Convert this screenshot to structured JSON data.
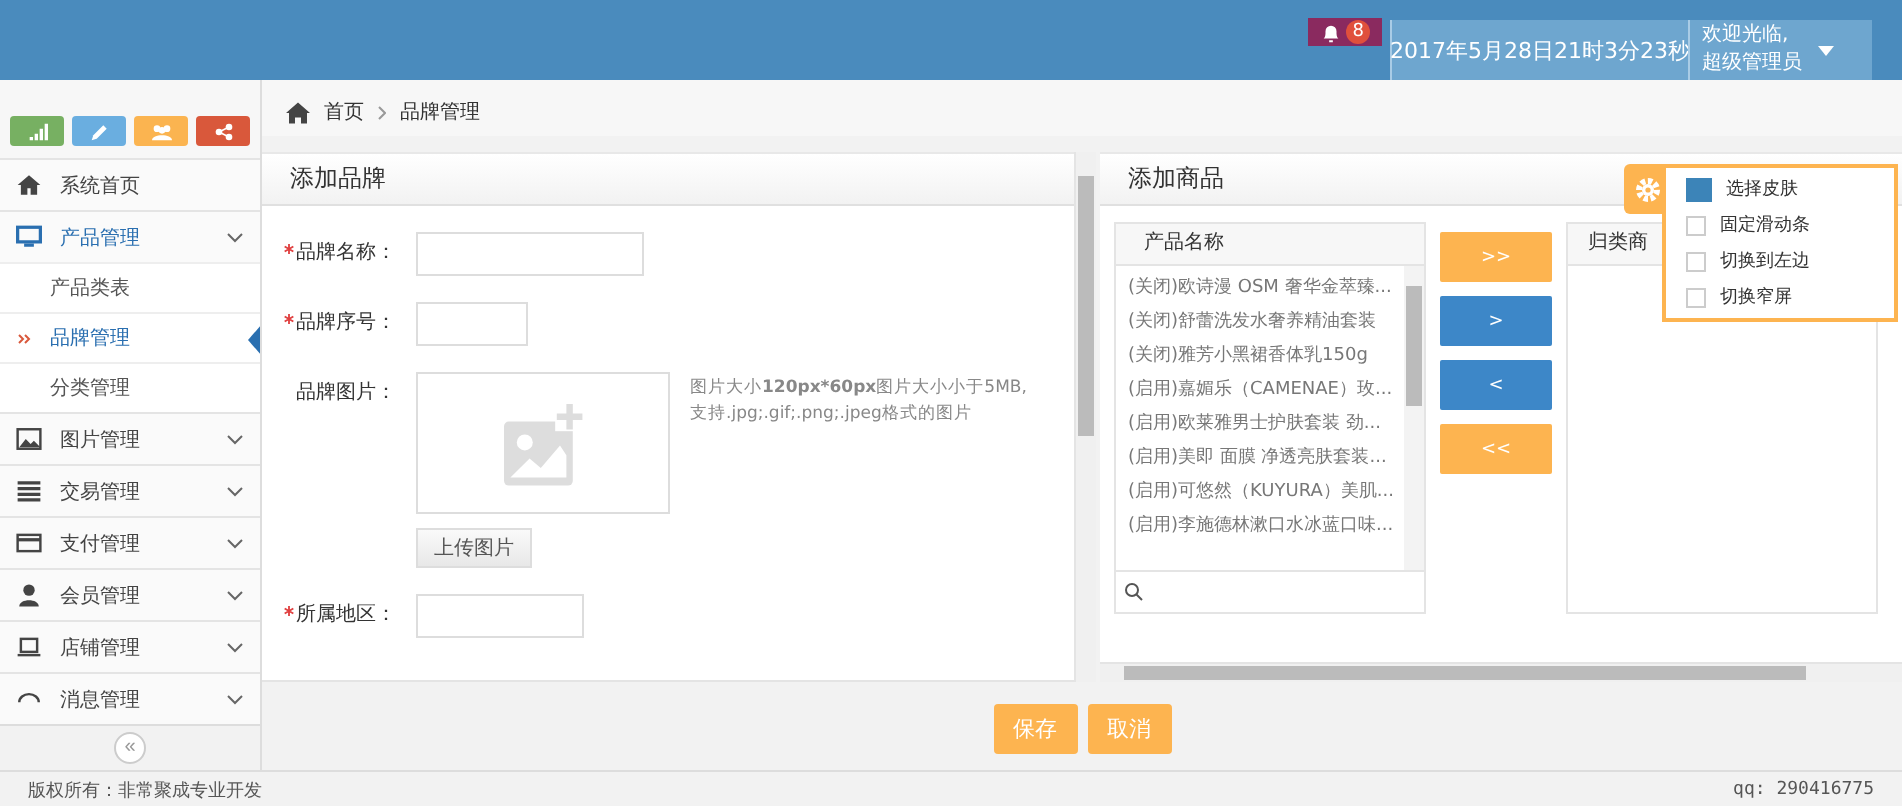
{
  "header": {
    "notification_count": "8",
    "datetime": "2017年5月28日21时3分23秒",
    "user": {
      "greeting": "欢迎光临,",
      "role": "超级管理员"
    }
  },
  "sidebar": {
    "shortcuts": [
      {
        "kind": "chart",
        "color": "#77b062"
      },
      {
        "kind": "pencil",
        "color": "#6aaee0"
      },
      {
        "kind": "users",
        "color": "#fbb450"
      },
      {
        "kind": "share",
        "color": "#d9583b"
      }
    ],
    "items": [
      {
        "label": "系统首页",
        "kind": "link",
        "expanded": false
      },
      {
        "label": "产品管理",
        "kind": "menu",
        "expanded": true,
        "children": [
          {
            "label": "产品类表",
            "selected": false
          },
          {
            "label": "品牌管理",
            "selected": true
          },
          {
            "label": "分类管理",
            "selected": false
          }
        ]
      },
      {
        "label": "图片管理",
        "kind": "menu",
        "expanded": false
      },
      {
        "label": "交易管理",
        "kind": "menu",
        "expanded": false
      },
      {
        "label": "支付管理",
        "kind": "menu",
        "expanded": false
      },
      {
        "label": "会员管理",
        "kind": "menu",
        "expanded": false
      },
      {
        "label": "店铺管理",
        "kind": "menu",
        "expanded": false
      },
      {
        "label": "消息管理",
        "kind": "menu",
        "expanded": false
      }
    ],
    "collapse": "«"
  },
  "breadcrumb": [
    "首页",
    "品牌管理"
  ],
  "brand_panel": {
    "title": "添加品牌",
    "fields": [
      {
        "label": "品牌名称：",
        "required": true,
        "kind": "wide"
      },
      {
        "label": "品牌序号：",
        "required": true,
        "kind": "narrow"
      },
      {
        "label": "品牌图片：",
        "required": false,
        "kind": "image",
        "hint": "图片大小**120px*60px**图片大小小于5MB,\n支持.jpg;.gif;.png;.jpeg格式的图片",
        "button": "上传图片"
      },
      {
        "label": "所属地区：",
        "required": true,
        "kind": "medium"
      }
    ]
  },
  "product_panel": {
    "title": "添加商品",
    "source_list": {
      "header": "产品名称",
      "items": [
        "(关闭)欧诗漫 OSM 奢华金萃臻...",
        "(关闭)舒蕾洗发水奢养精油套装",
        "(关闭)雅芳小黑裙香体乳150g",
        "(启用)嘉媚乐（CAMENAE）玫...",
        "(启用)欧莱雅男士护肤套装 劲...",
        "(启用)美即 面膜 净透亮肤套装...",
        "(启用)可悠然（KUYURA）美肌...",
        "(启用)李施德林漱口水冰蓝口味..."
      ]
    },
    "transfer_buttons": [
      {
        "label": ">>",
        "kind": "bulk"
      },
      {
        "label": ">",
        "kind": "single"
      },
      {
        "label": "<",
        "kind": "single"
      },
      {
        "label": "<<",
        "kind": "bulk"
      }
    ],
    "target_list": {
      "header": "归类商"
    }
  },
  "actions": [
    "保存",
    "取消"
  ],
  "skin_menu": [
    {
      "label": "选择皮肤",
      "kind": "swatch",
      "color": "#3c84b8"
    },
    {
      "label": "固定滑动条",
      "kind": "checkbox",
      "checked": false
    },
    {
      "label": "切换到左边",
      "kind": "checkbox",
      "checked": false
    },
    {
      "label": "切换窄屏",
      "kind": "checkbox",
      "checked": false
    }
  ],
  "footer": {
    "copyright": "版权所有：非常聚成专业开发",
    "qq": "qq: 290416775"
  }
}
